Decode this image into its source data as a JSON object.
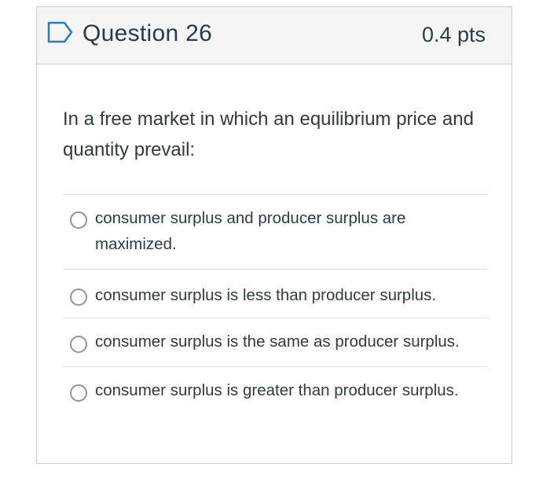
{
  "header": {
    "flag_icon": "flag-outline-icon",
    "title": "Question 26",
    "points": "0.4 pts"
  },
  "question": {
    "text": "In a free market in which an equilibrium price and quantity prevail:"
  },
  "answers": [
    {
      "label": "consumer surplus and producer surplus are maximized.",
      "selected": false
    },
    {
      "label": "consumer surplus is less than producer surplus.",
      "selected": false
    },
    {
      "label": "consumer surplus is the same as producer surplus.",
      "selected": false
    },
    {
      "label": "consumer surplus is greater than producer surplus.",
      "selected": false
    }
  ],
  "colors": {
    "flag": "#2b7abc",
    "text": "#2d3b45",
    "header_bg": "#f5f5f5",
    "border": "#c7cdd1"
  }
}
